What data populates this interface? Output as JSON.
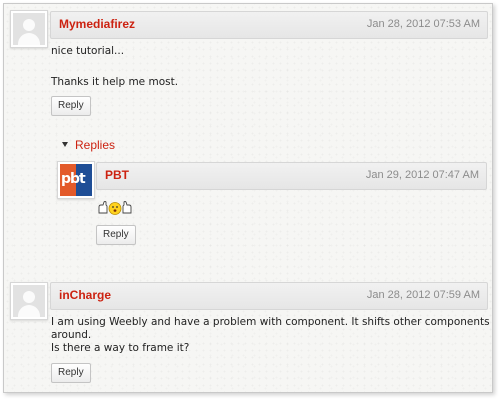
{
  "comments": [
    {
      "author": "Mymediafirez",
      "date": "Jan 28, 2012 07:53 AM",
      "lines": [
        "nice tutorial...",
        "Thanks it help me most."
      ],
      "reply_label": "Reply",
      "avatar": "default-user-icon"
    },
    {
      "author": "inCharge",
      "date": "Jan 28, 2012 07:59 AM",
      "lines": [
        "I am using Weebly and have a problem with component. It shifts other components",
        "around.",
        "Is there a way to frame it?"
      ],
      "reply_label": "Reply",
      "avatar": "default-user-icon"
    }
  ],
  "replies_section": {
    "label": "Replies",
    "items": [
      {
        "author": "PBT",
        "date": "Jan 29, 2012 07:47 AM",
        "content_icon": "thumbs-up-smiley-icon",
        "reply_label": "Reply",
        "avatar": "pbt-logo-icon",
        "avatar_text": "pbt"
      }
    ]
  },
  "colors": {
    "author": "#cc2211",
    "date": "#8c8c8c",
    "background": "#f6f6f4"
  }
}
